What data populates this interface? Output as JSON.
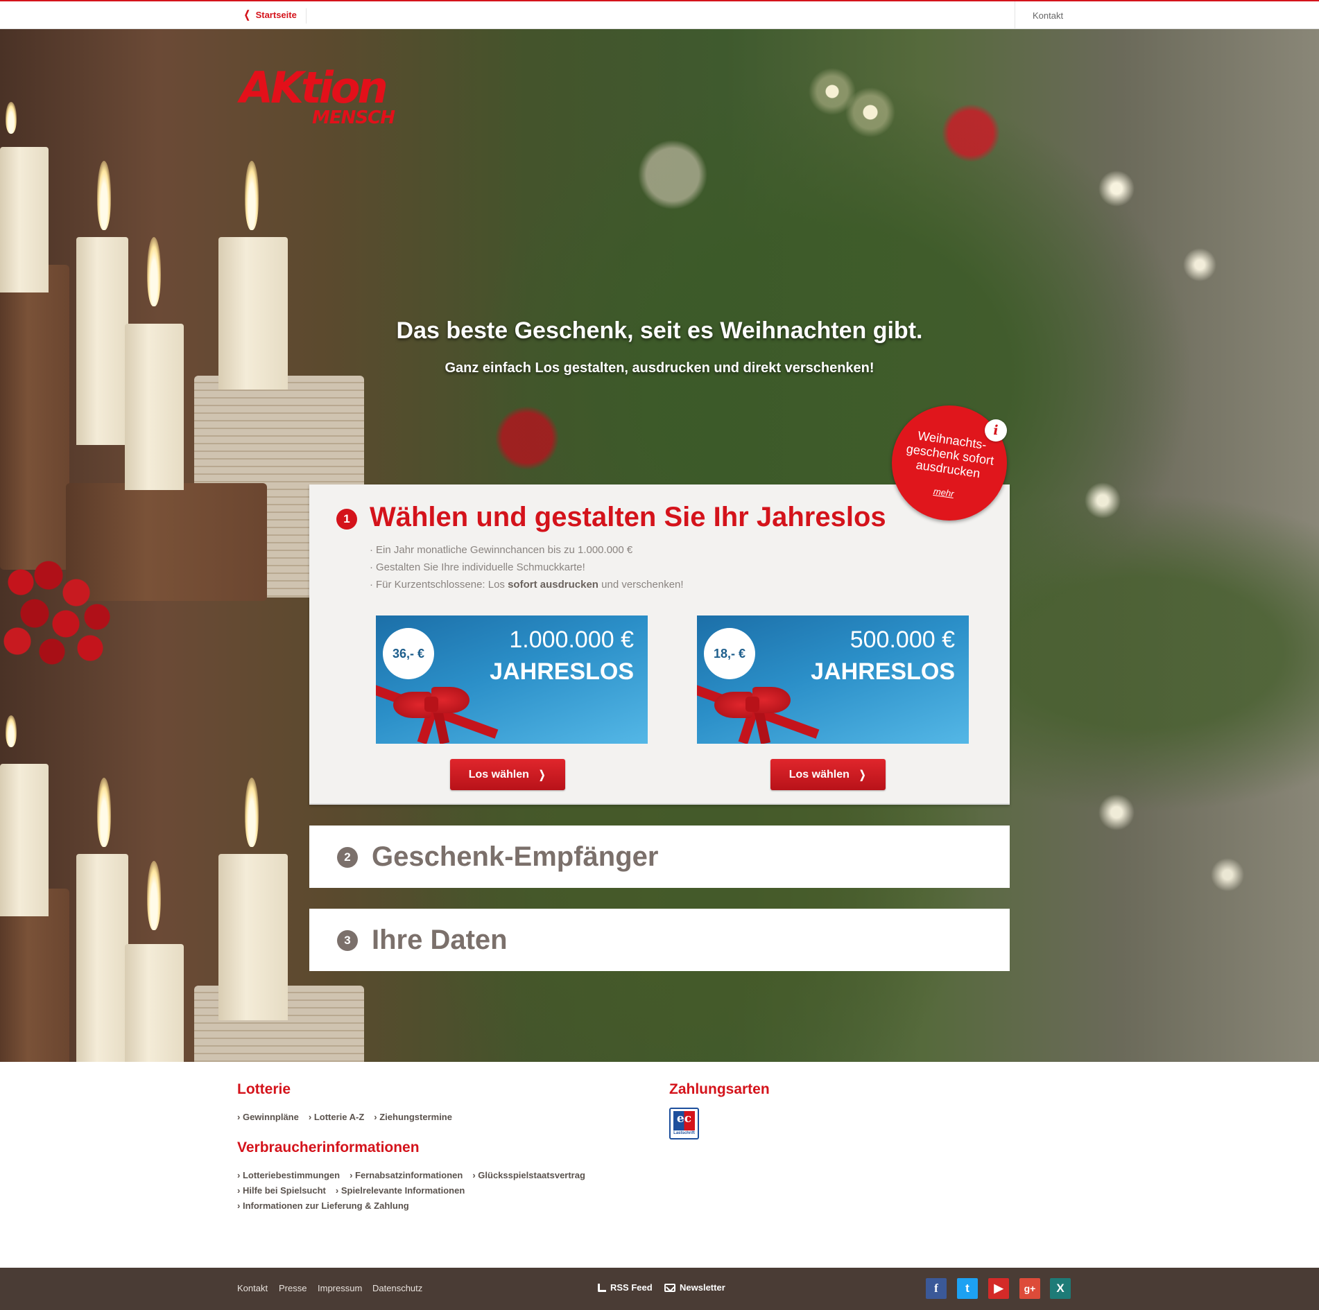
{
  "topbar": {
    "home_label": "Startseite",
    "contact_label": "Kontakt"
  },
  "logo": {
    "line1": "AKtion",
    "line2": "MENSCH"
  },
  "hero": {
    "headline": "Das beste Geschenk, seit es Weihnachten gibt.",
    "subline": "Ganz einfach Los gestalten, ausdrucken und direkt verschenken!"
  },
  "badge": {
    "text": "Weihnachts-geschenk sofort ausdrucken",
    "more_label": "mehr",
    "info_icon": "i"
  },
  "step1": {
    "number": "1",
    "title": "Wählen und gestalten Sie Ihr Jahreslos",
    "bullet1": "Ein Jahr monatliche Gewinnchancen bis zu 1.000.000 €",
    "bullet2": "Gestalten Sie Ihre individuelle Schmuckkarte!",
    "bullet3_prefix": "Für Kurzentschlossene: Los ",
    "bullet3_bold": "sofort ausdrucken",
    "bullet3_suffix": " und verschenken!",
    "tickets": [
      {
        "price": "36,- €",
        "amount": "1.000.000 €",
        "label": "JAHRESLOS",
        "button": "Los wählen"
      },
      {
        "price": "18,- €",
        "amount": "500.000 €",
        "label": "JAHRESLOS",
        "button": "Los wählen"
      }
    ]
  },
  "step2": {
    "number": "2",
    "title": "Geschenk-Empfänger"
  },
  "step3": {
    "number": "3",
    "title": "Ihre Daten"
  },
  "footer": {
    "lotterie_heading": "Lotterie",
    "lotterie_links": [
      "Gewinnpläne",
      "Lotterie A-Z",
      "Ziehungstermine"
    ],
    "verbraucher_heading": "Verbraucherinformationen",
    "verbraucher_links": [
      "Lotteriebestimmungen",
      "Fernabsatzinformationen",
      "Glücksspielstaatsvertrag",
      "Hilfe bei Spielsucht",
      "Spielrelevante Informationen",
      "Informationen zur Lieferung & Zahlung"
    ],
    "zahlung_heading": "Zahlungsarten",
    "ec_letters": "ec",
    "ec_caption": "Lastschrift"
  },
  "bottombar": {
    "links": [
      "Kontakt",
      "Presse",
      "Impressum",
      "Datenschutz"
    ],
    "rss_label": "RSS Feed",
    "newsletter_label": "Newsletter",
    "social": [
      {
        "name": "facebook-icon",
        "glyph": "f"
      },
      {
        "name": "twitter-icon",
        "glyph": "t"
      },
      {
        "name": "youtube-icon",
        "glyph": "▶"
      },
      {
        "name": "google-plus-icon",
        "glyph": "g+"
      },
      {
        "name": "xing-icon",
        "glyph": "X"
      }
    ]
  },
  "colors": {
    "brand_red": "#d4131b",
    "footer_brown": "#4a3c35",
    "step_grey": "#7b706b"
  }
}
